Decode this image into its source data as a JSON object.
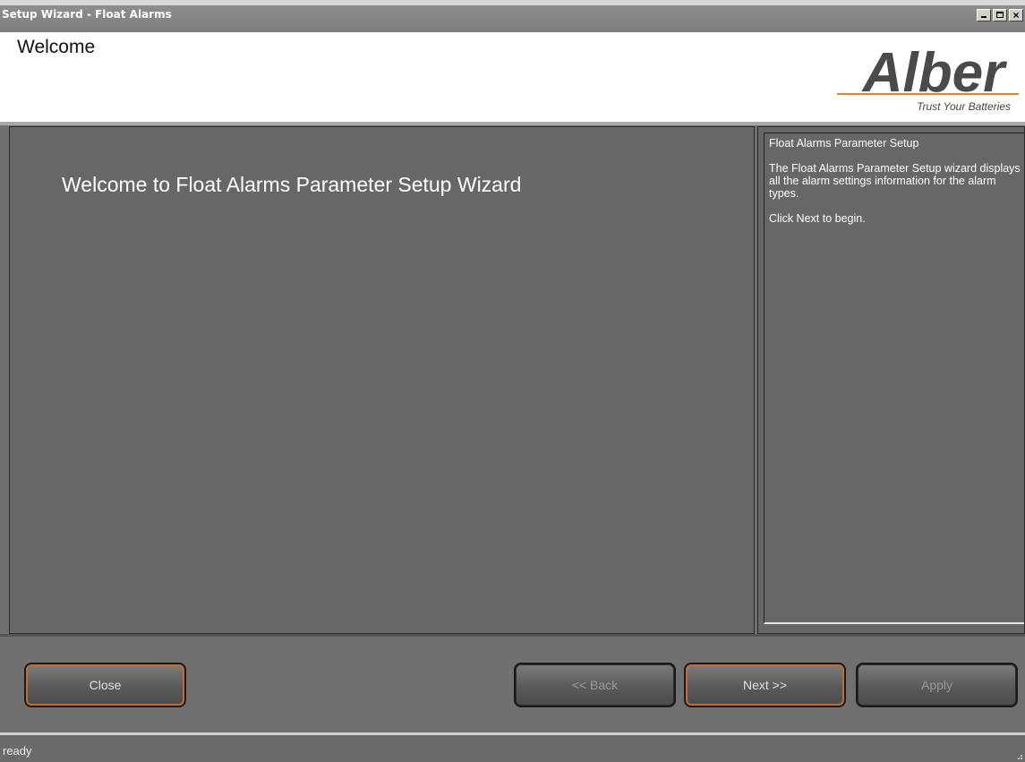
{
  "window": {
    "title": "Setup Wizard - Float Alarms",
    "controls": {
      "minimize": "_",
      "maximize": "□",
      "close": "×"
    }
  },
  "header": {
    "page_title": "Welcome",
    "logo": {
      "name": "Alber",
      "tagline": "Trust Your Batteries",
      "accent_color": "#e8831f",
      "text_color": "#4a4a4a"
    }
  },
  "main": {
    "welcome_text": "Welcome to Float Alarms Parameter Setup Wizard"
  },
  "help": {
    "heading": "Float Alarms Parameter Setup",
    "description": "The Float Alarms Parameter Setup wizard displays all the alarm settings information for the alarm types.",
    "instruction": "Click Next to begin."
  },
  "buttons": {
    "close": "Close",
    "back": "<< Back",
    "next": "Next >>",
    "apply": "Apply"
  },
  "status": {
    "text": "ready"
  }
}
